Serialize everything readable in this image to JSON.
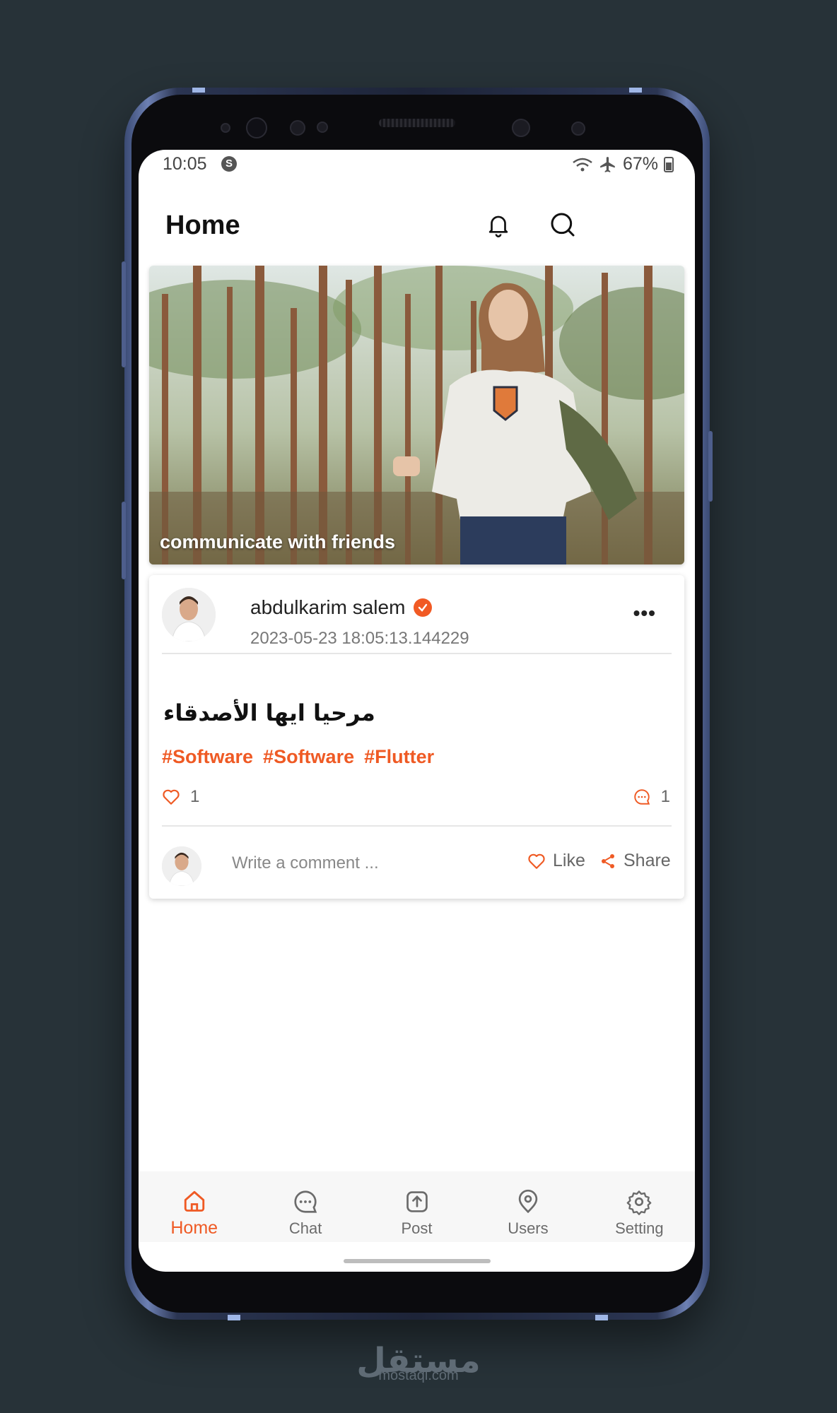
{
  "status_bar": {
    "time": "10:05",
    "s_badge": "S",
    "battery": "67%"
  },
  "app_bar": {
    "title": "Home",
    "notification_icon": "bell-icon",
    "search_icon": "search-icon"
  },
  "banner": {
    "caption": "communicate with friends"
  },
  "post": {
    "author": "abdulkarim salem",
    "verified": true,
    "timestamp": "2023-05-23 18:05:13.144229",
    "text": "مرحيا ايها الأصدقاء",
    "tags": [
      "#Software",
      "#Software",
      "#Flutter"
    ],
    "likes": "1",
    "comments": "1",
    "comment_placeholder": "Write a comment ...",
    "like_label": "Like",
    "share_label": "Share"
  },
  "bottom_nav": [
    {
      "label": "Home",
      "icon": "home-icon",
      "active": true
    },
    {
      "label": "Chat",
      "icon": "chat-icon",
      "active": false
    },
    {
      "label": "Post",
      "icon": "upload-icon",
      "active": false
    },
    {
      "label": "Users",
      "icon": "location-pin-icon",
      "active": false
    },
    {
      "label": "Setting",
      "icon": "gear-icon",
      "active": false
    }
  ],
  "watermark": {
    "arabic": "مستقل",
    "domain": "mostaql.com"
  },
  "colors": {
    "accent": "#ef5a24",
    "background": "#273238"
  }
}
